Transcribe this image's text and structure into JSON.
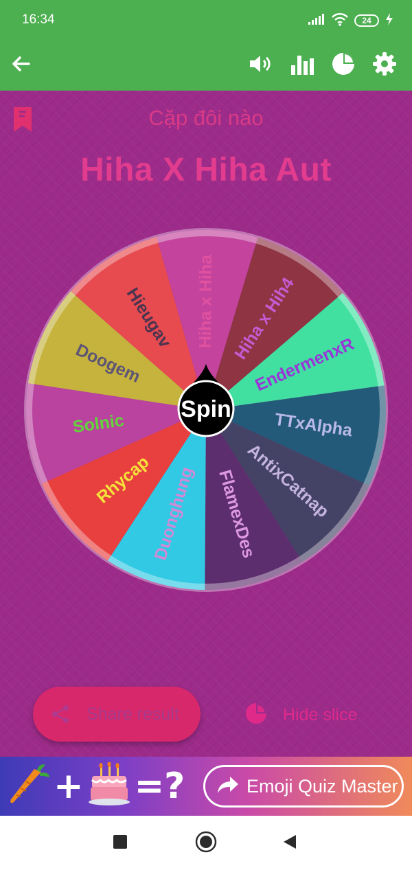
{
  "status_bar": {
    "time": "16:34",
    "battery": "24",
    "icons": [
      "signal-icon",
      "wifi-icon",
      "battery-icon",
      "charging-icon"
    ]
  },
  "app_bar": {
    "background": "#4caf50",
    "actions": [
      "back-arrow-icon",
      "volume-icon",
      "bar-chart-icon",
      "pie-chart-icon",
      "gear-icon"
    ]
  },
  "main": {
    "subtitle": "Cặp đôi nào",
    "title": "Hiha X Hiha Aut",
    "background": "#9c2b89"
  },
  "wheel": {
    "spin_label": "Spin",
    "slices": [
      {
        "label": "Hiha x Hiha",
        "color": "#c3439d",
        "text_color": "#e0519f"
      },
      {
        "label": "Hiha x Hih4",
        "color": "#8e3442",
        "text_color": "#c35cd0"
      },
      {
        "label": "EndermenxR",
        "color": "#41e0a1",
        "text_color": "#9836d6"
      },
      {
        "label": "TTxAlpha",
        "color": "#245a79",
        "text_color": "#b8b9e6"
      },
      {
        "label": "AntixCatnap",
        "color": "#444366",
        "text_color": "#c4b4df"
      },
      {
        "label": "FlamexDes",
        "color": "#5d2e6d",
        "text_color": "#dd98e3"
      },
      {
        "label": "Duonghung",
        "color": "#31c9e3",
        "text_color": "#d08ad6"
      },
      {
        "label": "Rhycap",
        "color": "#e8403f",
        "text_color": "#f5e33a"
      },
      {
        "label": "Solnic",
        "color": "#b9439e",
        "text_color": "#62d33c"
      },
      {
        "label": "Doogem",
        "color": "#c5b33e",
        "text_color": "#5e5574"
      },
      {
        "label": "Hieugav",
        "color": "#e74a4f",
        "text_color": "#4a3450"
      }
    ]
  },
  "actions": {
    "share_label": "Share result",
    "hide_label": "Hide slice",
    "share_color": "#d8286c"
  },
  "ad": {
    "left_symbols": [
      "carrot-icon",
      "+",
      "cake-icon",
      "=?"
    ],
    "plus": "+",
    "equals": "=?",
    "cta_label": "Emoji Quiz Master"
  },
  "nav_bar": {
    "buttons": [
      "recents-square-icon",
      "home-circle-icon",
      "back-triangle-icon"
    ]
  }
}
